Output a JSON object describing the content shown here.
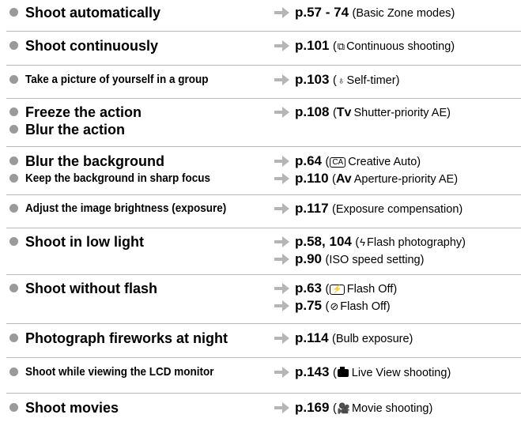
{
  "sections": [
    {
      "rows": [
        {
          "task": "Shoot automatically",
          "style": "large",
          "refs": [
            {
              "page": "p.57 - 74",
              "paren_text": "Basic Zone modes"
            }
          ]
        }
      ]
    },
    {
      "rows": [
        {
          "task": "Shoot continuously",
          "style": "large",
          "refs": [
            {
              "page": "p.101",
              "icon": "continuous-shooting-icon",
              "paren_text": "Continuous shooting"
            }
          ]
        }
      ]
    },
    {
      "rows": [
        {
          "task": "Take a picture of yourself in a group",
          "style": "cond",
          "refs": [
            {
              "page": "p.103",
              "icon": "self-timer-icon",
              "paren_text": "Self-timer"
            }
          ]
        }
      ]
    },
    {
      "rows": [
        {
          "task": "Freeze the action",
          "style": "large",
          "refs": [
            {
              "page": "p.108",
              "mode": "Tv",
              "paren_text": "Shutter-priority AE"
            }
          ]
        },
        {
          "task": "Blur the action",
          "style": "large",
          "refs": []
        }
      ]
    },
    {
      "rows": [
        {
          "task": "Blur the background",
          "style": "large",
          "refs": [
            {
              "page": "p.64",
              "box": "CA",
              "paren_text": "Creative Auto"
            }
          ]
        },
        {
          "task": "Keep the background in sharp focus",
          "style": "cond",
          "refs": [
            {
              "page": "p.110",
              "mode": "Av",
              "paren_text": "Aperture-priority AE"
            }
          ]
        }
      ]
    },
    {
      "rows": [
        {
          "task": "Adjust the image brightness (exposure)",
          "style": "cond",
          "refs": [
            {
              "page": "p.117",
              "paren_text": "Exposure compensation"
            }
          ]
        }
      ]
    },
    {
      "rows": [
        {
          "task": "Shoot in low light",
          "style": "large",
          "refs": [
            {
              "page": "p.58",
              "page2": "104",
              "icon": "flash-icon",
              "paren_text": "Flash photography"
            }
          ]
        },
        {
          "task": "",
          "style": "large",
          "refs": [
            {
              "page": "p.90",
              "paren_text": "ISO speed setting"
            }
          ]
        }
      ]
    },
    {
      "rows": [
        {
          "task": "Shoot without flash",
          "style": "large",
          "refs": [
            {
              "page": "p.63",
              "box": "⚡",
              "paren_text": "Flash Off"
            }
          ]
        },
        {
          "task": "",
          "style": "large",
          "refs": [
            {
              "page": "p.75",
              "icon": "flash-off-mode-icon",
              "paren_text": "Flash Off"
            }
          ]
        }
      ]
    },
    {
      "rows": [
        {
          "task": "Photograph fireworks at night",
          "style": "large",
          "refs": [
            {
              "page": "p.114",
              "paren_text": "Bulb exposure"
            }
          ]
        }
      ]
    },
    {
      "rows": [
        {
          "task": "Shoot while viewing the LCD monitor",
          "style": "cond",
          "refs": [
            {
              "page": "p.143",
              "icon": "live-view-icon",
              "paren_text": "Live View shooting"
            }
          ]
        }
      ]
    },
    {
      "rows": [
        {
          "task": "Shoot movies",
          "style": "large",
          "refs": [
            {
              "page": "p.169",
              "icon": "movie-icon",
              "paren_text": "Movie shooting"
            }
          ]
        }
      ]
    }
  ],
  "glyphs": {
    "continuous-shooting-icon": "⧉",
    "self-timer-icon": "♁",
    "flash-icon": "ϟ",
    "flash-off-mode-icon": "⊘",
    "movie-icon": "🎥"
  },
  "colors": {
    "divider": "#b8b8b8",
    "bullet": "#9a9a9a",
    "arrow": "#b5b5b5"
  }
}
